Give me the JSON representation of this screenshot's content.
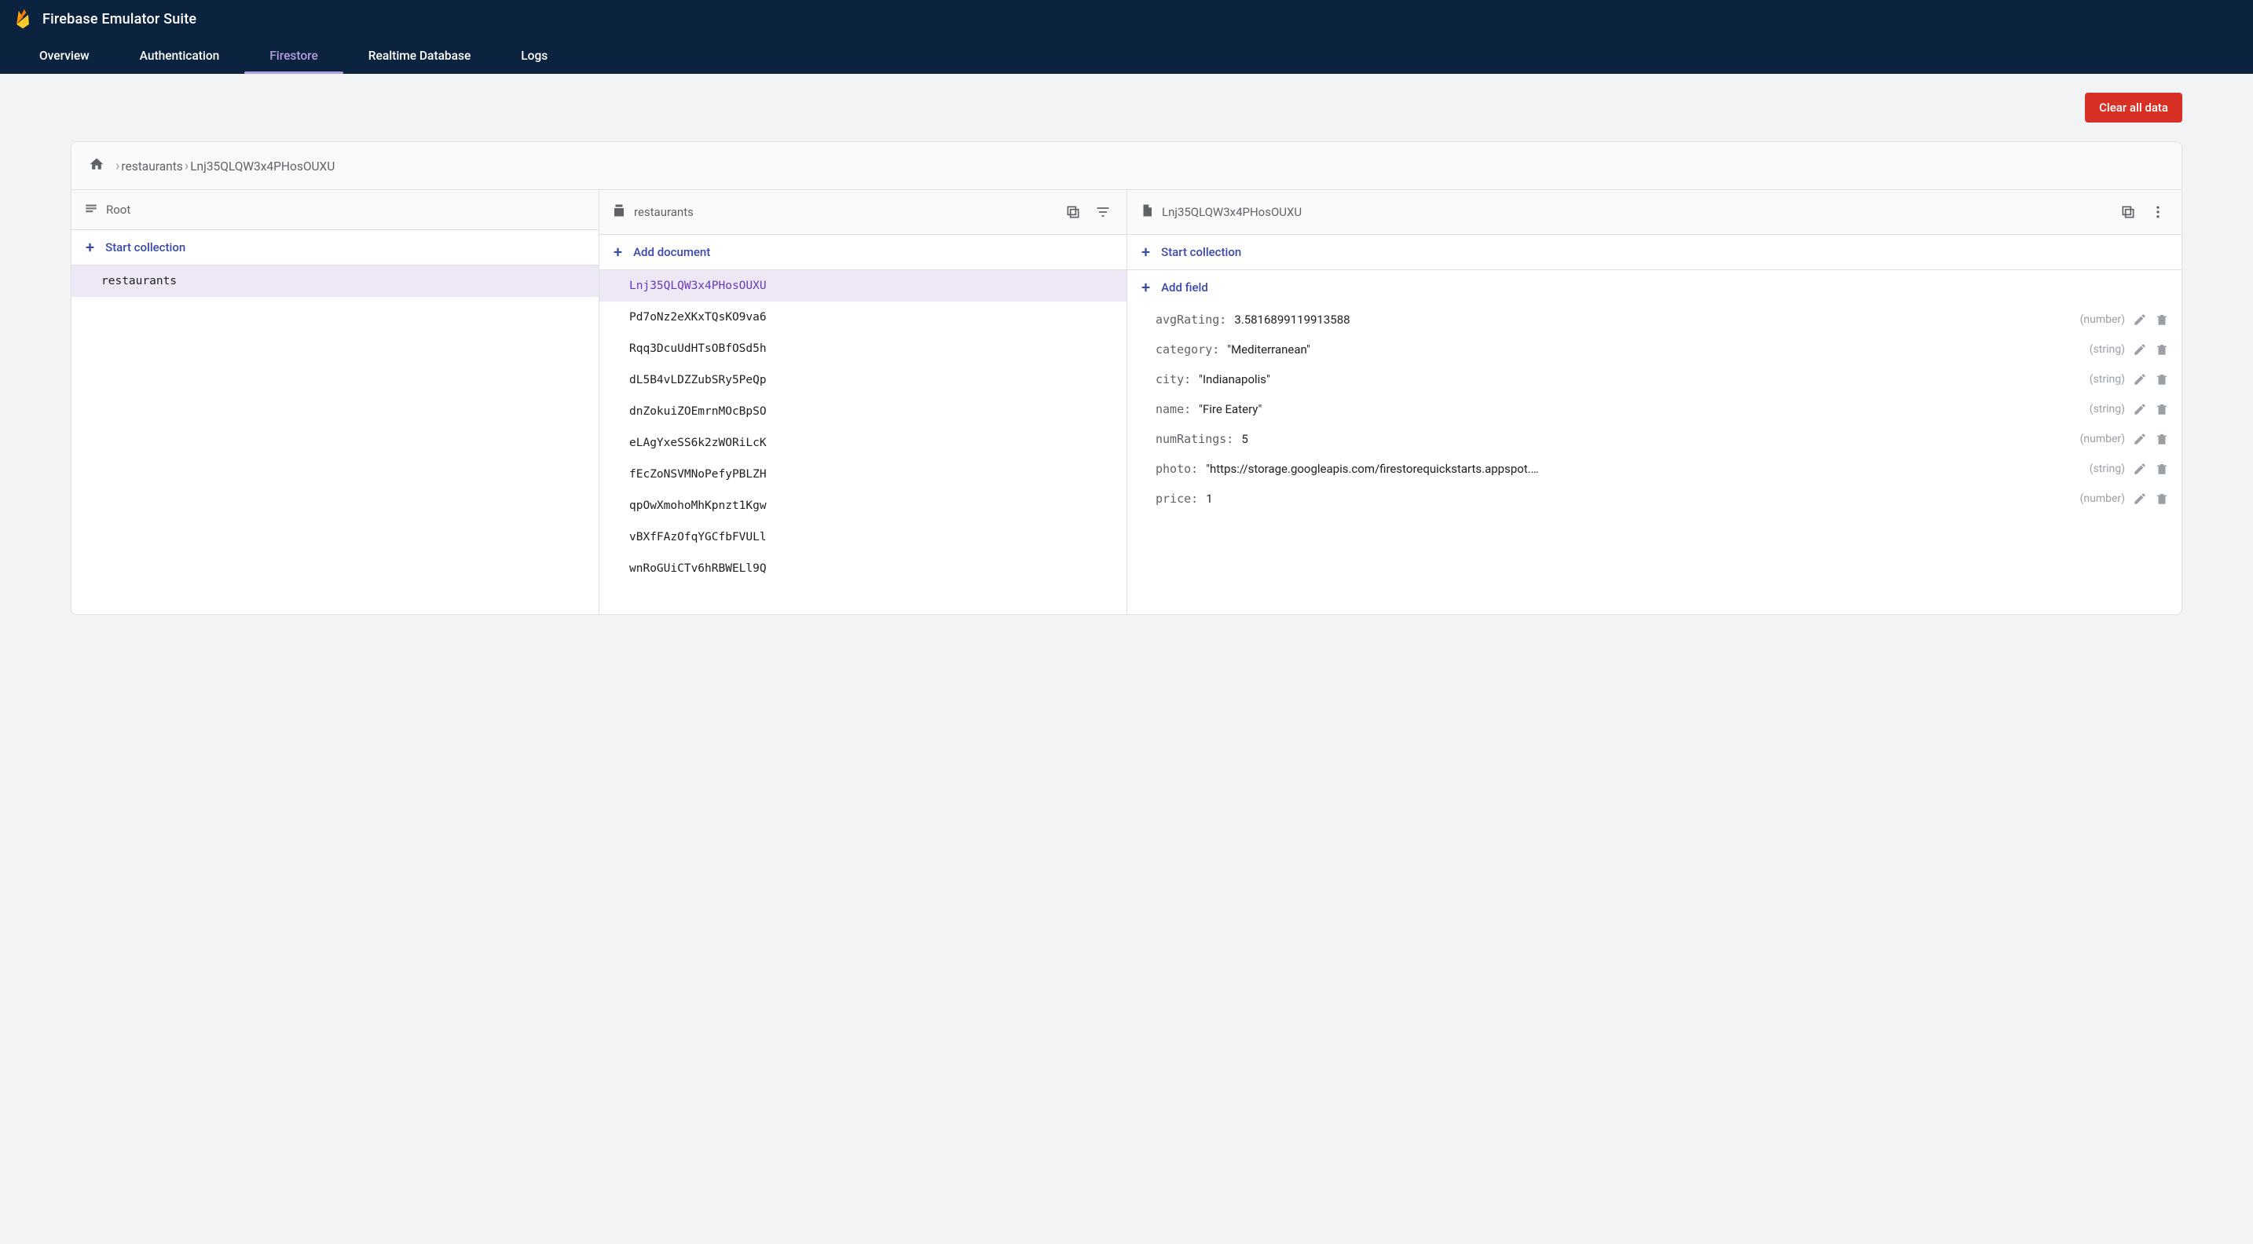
{
  "header": {
    "title": "Firebase Emulator Suite",
    "tabs": [
      {
        "label": "Overview",
        "active": false
      },
      {
        "label": "Authentication",
        "active": false
      },
      {
        "label": "Firestore",
        "active": true
      },
      {
        "label": "Realtime Database",
        "active": false
      },
      {
        "label": "Logs",
        "active": false
      }
    ]
  },
  "toolbar": {
    "clear_button": "Clear all data"
  },
  "breadcrumbs": {
    "items": [
      "restaurants",
      "Lnj35QLQW3x4PHosOUXU"
    ]
  },
  "col_root": {
    "header": "Root",
    "action": "Start collection",
    "collections": [
      {
        "name": "restaurants",
        "selected": true
      }
    ]
  },
  "col_docs": {
    "header": "restaurants",
    "action": "Add document",
    "documents": [
      {
        "id": "Lnj35QLQW3x4PHosOUXU",
        "selected": true
      },
      {
        "id": "Pd7oNz2eXKxTQsKO9va6",
        "selected": false
      },
      {
        "id": "Rqq3DcuUdHTsOBfOSd5h",
        "selected": false
      },
      {
        "id": "dL5B4vLDZZubSRy5PeQp",
        "selected": false
      },
      {
        "id": "dnZokuiZOEmrnMOcBpSO",
        "selected": false
      },
      {
        "id": "eLAgYxeSS6k2zWORiLcK",
        "selected": false
      },
      {
        "id": "fEcZoNSVMNoPefyPBLZH",
        "selected": false
      },
      {
        "id": "qpOwXmohoMhKpnzt1Kgw",
        "selected": false
      },
      {
        "id": "vBXfFAzOfqYGCfbFVULl",
        "selected": false
      },
      {
        "id": "wnRoGUiCTv6hRBWELl9Q",
        "selected": false
      }
    ]
  },
  "col_doc": {
    "header": "Lnj35QLQW3x4PHosOUXU",
    "action_collection": "Start collection",
    "action_field": "Add field",
    "fields": [
      {
        "key": "avgRating",
        "value": "3.5816899119913588",
        "type": "(number)",
        "isString": false
      },
      {
        "key": "category",
        "value": "\"Mediterranean\"",
        "type": "(string)",
        "isString": true
      },
      {
        "key": "city",
        "value": "\"Indianapolis\"",
        "type": "(string)",
        "isString": true
      },
      {
        "key": "name",
        "value": "\"Fire Eatery\"",
        "type": "(string)",
        "isString": true
      },
      {
        "key": "numRatings",
        "value": "5",
        "type": "(number)",
        "isString": false
      },
      {
        "key": "photo",
        "value": "\"https://storage.googleapis.com/firestorequickstarts.appspot.…",
        "type": "(string)",
        "isString": true
      },
      {
        "key": "price",
        "value": "1",
        "type": "(number)",
        "isString": false
      }
    ]
  }
}
